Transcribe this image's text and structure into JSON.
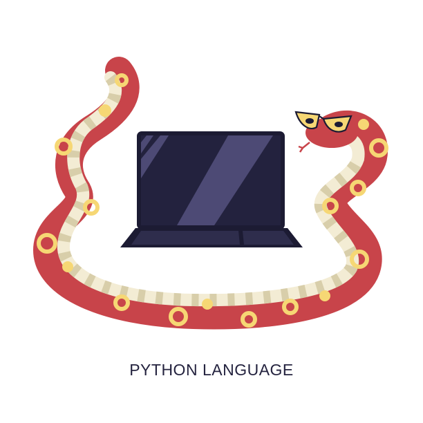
{
  "caption": "PYTHON LANGUAGE",
  "colors": {
    "snake_body": "#c8444a",
    "snake_belly": "#f3ecd4",
    "snake_band": "#d8ceaa",
    "spots": "#f6d774",
    "laptop_body": "#1c1b33",
    "laptop_screen": "#23223e",
    "screen_glare": "#4d4a75",
    "caption": "#24233f"
  },
  "icons": [
    "python-snake-illustration",
    "laptop-illustration",
    "glasses-illustration"
  ]
}
